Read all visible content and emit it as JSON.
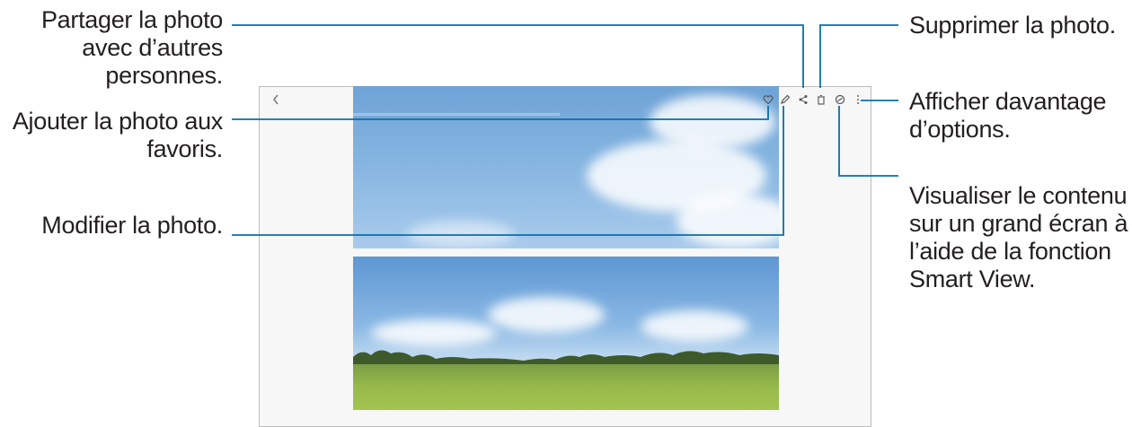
{
  "callouts": {
    "share": "Partager la photo\navec d’autres\npersonnes.",
    "favorite": "Ajouter la photo aux\nfavoris.",
    "edit": "Modifier la photo.",
    "delete": "Supprimer la photo.",
    "more": "Afficher davantage\nd’options.",
    "smart_view": "Visualiser le contenu\nsur un grand écran à\nl’aide de la fonction\nSmart View."
  },
  "toolbar": {
    "icons": [
      "back-icon",
      "heart-icon",
      "pencil-icon",
      "share-icon",
      "trash-icon",
      "smart-view-icon",
      "more-icon"
    ]
  },
  "colors": {
    "leader": "#0a6fa8",
    "frame": "#bdbdbd"
  }
}
